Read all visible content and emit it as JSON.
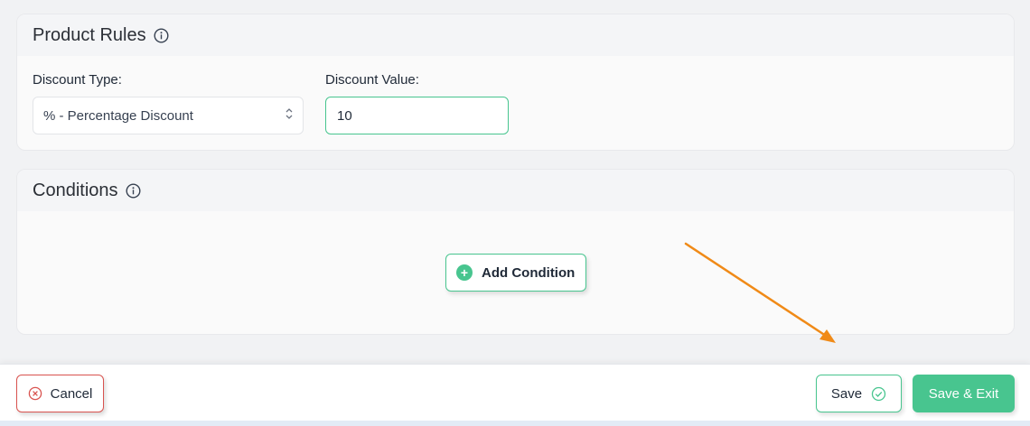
{
  "product_rules": {
    "title": "Product Rules",
    "discount_type_label": "Discount Type:",
    "discount_type_value": "% - Percentage Discount",
    "discount_value_label": "Discount Value:",
    "discount_value": "10"
  },
  "conditions": {
    "title": "Conditions",
    "add_condition_label": "Add Condition"
  },
  "footer": {
    "cancel_label": "Cancel",
    "save_label": "Save",
    "save_exit_label": "Save & Exit"
  },
  "colors": {
    "accent": "#48c58f",
    "danger": "#d9534f",
    "annotation_arrow": "#f08a17"
  },
  "icons": {
    "info": "info-icon",
    "select_caret": "chevron-up-down-icon",
    "add": "plus-circle-icon",
    "cancel": "x-circle-icon",
    "save": "check-circle-icon",
    "annotation": "arrow-icon"
  }
}
